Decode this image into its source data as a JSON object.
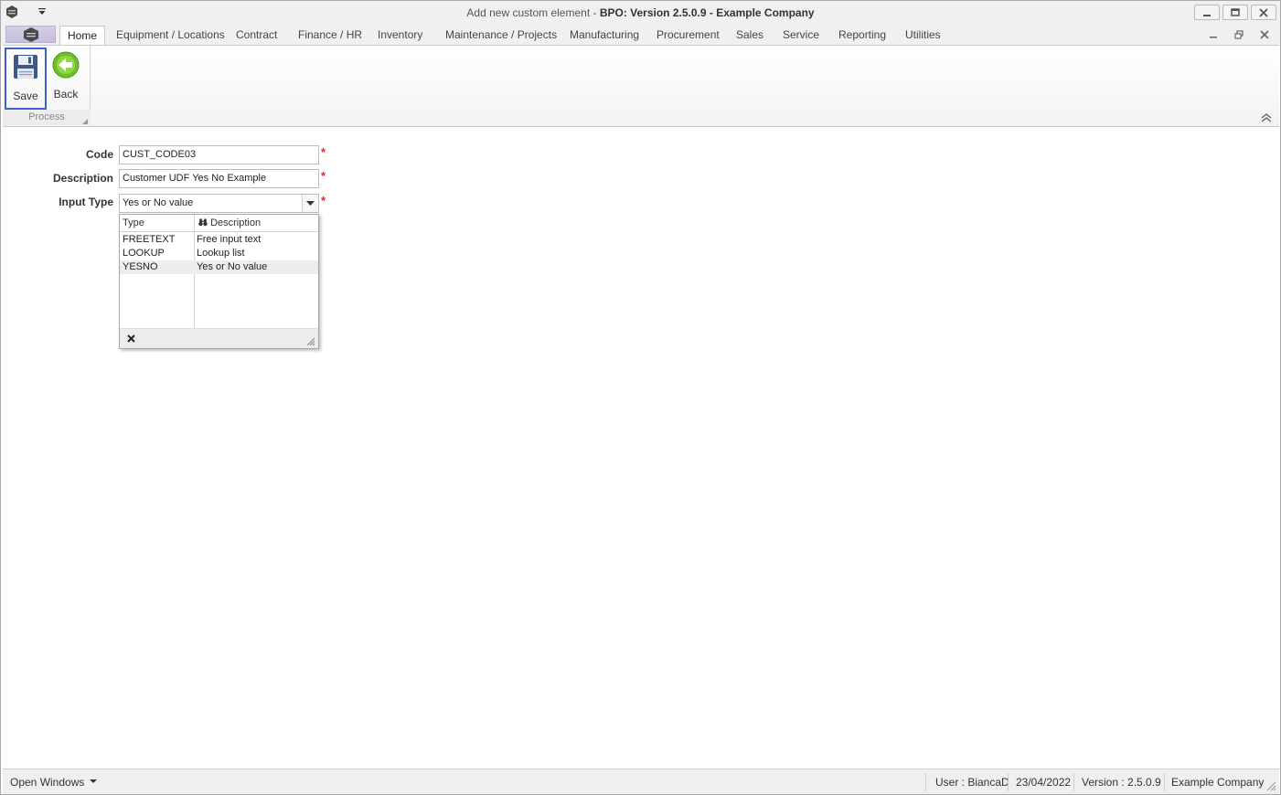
{
  "window": {
    "title_prefix": "Add new custom element - ",
    "title_main": "BPO: Version 2.5.0.9 - Example Company"
  },
  "tabs": [
    {
      "label": "Home"
    },
    {
      "label": "Equipment / Locations"
    },
    {
      "label": "Contract"
    },
    {
      "label": "Finance / HR"
    },
    {
      "label": "Inventory"
    },
    {
      "label": "Maintenance / Projects"
    },
    {
      "label": "Manufacturing"
    },
    {
      "label": "Procurement"
    },
    {
      "label": "Sales"
    },
    {
      "label": "Service"
    },
    {
      "label": "Reporting"
    },
    {
      "label": "Utilities"
    }
  ],
  "ribbon": {
    "save_label": "Save",
    "back_label": "Back",
    "group_label": "Process"
  },
  "form": {
    "code_label": "Code",
    "code_value": "CUST_CODE03",
    "description_label": "Description",
    "description_value": "Customer UDF Yes No Example",
    "input_type_label": "Input Type",
    "input_type_value": "Yes or No value",
    "required_mark": "*"
  },
  "dropdown": {
    "col_type": "Type",
    "col_description": "Description",
    "rows": [
      {
        "type": "FREETEXT",
        "description": "Free input text"
      },
      {
        "type": "LOOKUP",
        "description": "Lookup list"
      },
      {
        "type": "YESNO",
        "description": "Yes or No value"
      }
    ]
  },
  "statusbar": {
    "open_windows": "Open Windows",
    "user": "User : BiancaD",
    "date": "23/04/2022",
    "version": "Version : 2.5.0.9",
    "company": "Example Company"
  },
  "colors": {
    "accent": "#3c62c9",
    "required": "#e0262b",
    "back_icon": "#6fbf2a"
  }
}
